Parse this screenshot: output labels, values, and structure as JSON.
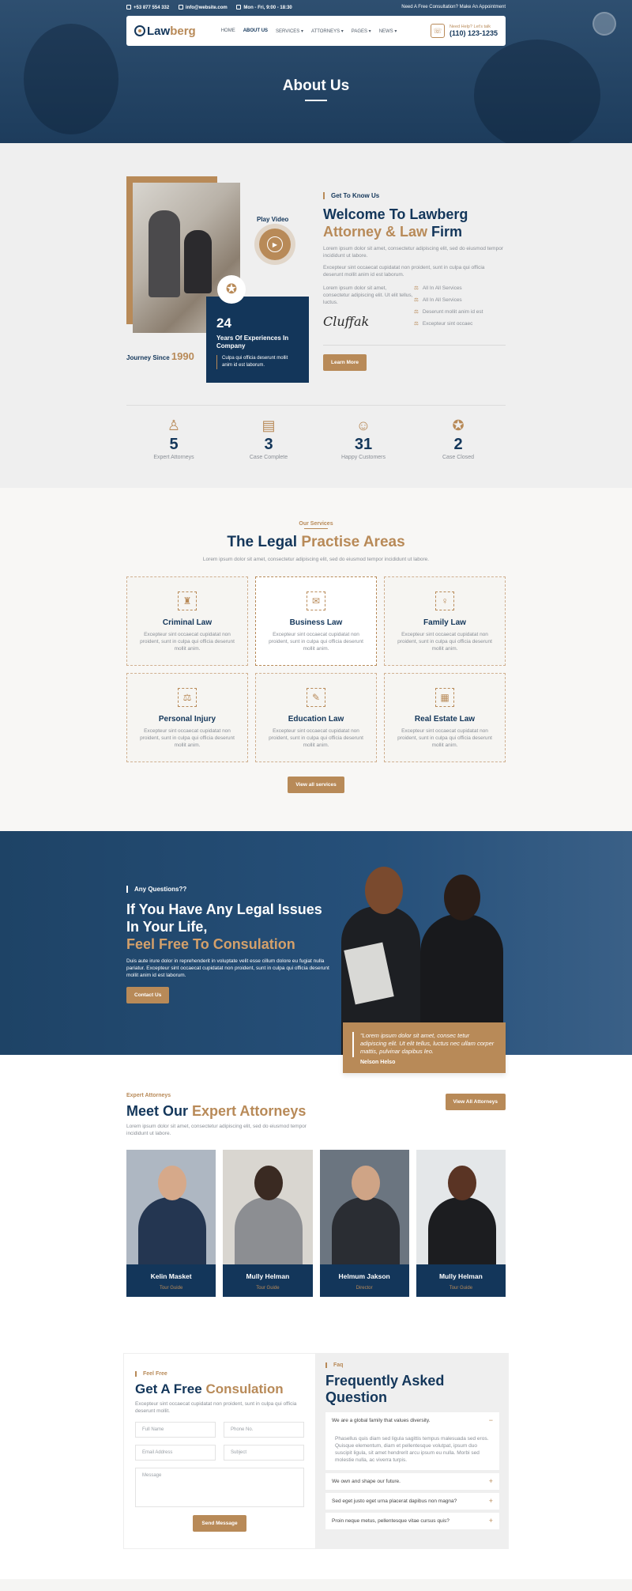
{
  "topbar": {
    "phone": "+53 877 554 332",
    "email": "info@website.com",
    "hours": "Mon - Fri, 9:00 - 18:30",
    "consult": "Need A Free Consultation? Make An Appointment"
  },
  "nav": {
    "logo_a": "Law",
    "logo_b": "berg",
    "items": [
      "HOME",
      "ABOUT US",
      "SERVICES ▾",
      "ATTORNEYS ▾",
      "PAGES ▾",
      "NEWS ▾"
    ],
    "help_label": "Need Help? Let's talk",
    "help_phone": "(110) 123-1235"
  },
  "hero": {
    "title": "About Us"
  },
  "about": {
    "play_label": "Play Video",
    "years": "24",
    "years_label": "Years Of Experiences In Company",
    "years_desc": "Culpa qui officia deserunt mollit anim id est laborum.",
    "journey_label": "Journey Since",
    "journey_year": "1990",
    "eyebrow": "Get To Know Us",
    "title_a": "Welcome To Lawberg",
    "title_b": "Attorney & Law",
    "title_c": "Firm",
    "p1": "Lorem ipsum dolor sit amet, consectetur adipiscing elit, sed do eiusmod tempor incididunt ut labore.",
    "p2": "Excepteur sint occaecat cupidatat non proident, sunt in culpa qui officia deserunt mollit anim id est laborum.",
    "p3": "Lorem ipsum dolor sit amet, consectetur adipiscing elit. Ut elit tellus, luctus.",
    "list": [
      "All In All Services",
      "All In All Services",
      "Deserunt mollit anim id est",
      "Excepteur sint occaec"
    ],
    "signature": "Cluffak",
    "button": "Learn More"
  },
  "stats": [
    {
      "icon": "♙",
      "num": "5",
      "label": "Expert Attorneys"
    },
    {
      "icon": "▤",
      "num": "3",
      "label": "Case Complete"
    },
    {
      "icon": "☺",
      "num": "31",
      "label": "Happy Customers"
    },
    {
      "icon": "✪",
      "num": "2",
      "label": "Case Closed"
    }
  ],
  "services": {
    "eyebrow": "Our Services",
    "title_a": "The Legal",
    "title_b": "Practise Areas",
    "sub": "Lorem ipsum dolor sit amet, consectetur adipiscing elit, sed do eiusmod tempor incididunt ut labore.",
    "cards": [
      {
        "icon": "♜",
        "title": "Criminal Law",
        "desc": "Excepteur sint occaecat cupidatat non proident, sunt in culpa qui officia deserunt mollit anim."
      },
      {
        "icon": "✉",
        "title": "Business Law",
        "desc": "Excepteur sint occaecat cupidatat non proident, sunt in culpa qui officia deserunt mollit anim."
      },
      {
        "icon": "♀",
        "title": "Family Law",
        "desc": "Excepteur sint occaecat cupidatat non proident, sunt in culpa qui officia deserunt mollit anim."
      },
      {
        "icon": "⚖",
        "title": "Personal Injury",
        "desc": "Excepteur sint occaecat cupidatat non proident, sunt in culpa qui officia deserunt mollit anim."
      },
      {
        "icon": "✎",
        "title": "Education Law",
        "desc": "Excepteur sint occaecat cupidatat non proident, sunt in culpa qui officia deserunt mollit anim."
      },
      {
        "icon": "▦",
        "title": "Real Estate Law",
        "desc": "Excepteur sint occaecat cupidatat non proident, sunt in culpa qui officia deserunt mollit anim."
      }
    ],
    "button": "View all services"
  },
  "cta": {
    "eyebrow": "Any Questions??",
    "title_a": "If You Have Any Legal Issues In Your Life,",
    "title_b": "Feel Free To Consulation",
    "text": "Duis aute irure dolor in reprehenderit in voluptate velit esse cillum dolore eu fugiat nulla pariatur. Excepteur sint occaecat cupidatat non proident, sunt in culpa qui officia deserunt mollit anim id est laborum.",
    "button": "Contact Us",
    "quote": "\"Lorem ipsum dolor sit amet, consec tetur adipiscing elit. Ut elit tellus, luctus nec ullam corper mattis, pulvinar dapibus leo.",
    "quote_name": "Nelson Helso"
  },
  "team": {
    "eyebrow": "Expert Attorneys",
    "title_a": "Meet Our",
    "title_b": "Expert Attorneys",
    "sub": "Lorem ipsum dolor sit amet, consectetur adipiscing elit, sed do eiusmod tempor incididunt ut labore.",
    "button": "View All Attorneys",
    "members": [
      {
        "name": "Kelin Masket",
        "role": "Tour Guide"
      },
      {
        "name": "Mully Helman",
        "role": "Tour Guide"
      },
      {
        "name": "Helmum Jakson",
        "role": "Director"
      },
      {
        "name": "Mully Helman",
        "role": "Tour Guide"
      }
    ]
  },
  "contact": {
    "eyebrow": "Feel Free",
    "title_a": "Get A Free",
    "title_b": "Consulation",
    "text": "Excepteur sint occaecat cupidatat non proident, sunt in culpa qui officia deserunt mollit.",
    "ph_name": "Full Name",
    "ph_phone": "Phone No.",
    "ph_email": "Email Address",
    "ph_subject": "Subject",
    "ph_message": "Message",
    "button": "Send Message"
  },
  "faq": {
    "eyebrow": "Faq",
    "title": "Frequently Asked Question",
    "q1": "We are a global family that values diversity.",
    "a1": "Phasellus quis diam sed ligula sagittis tempus malesuada sed eros. Quisque elementum, diam et pellentesque volutpat, ipsum duo suscipit ligula, sit amet hendrerit arcu ipsum eu nulla. Morbi sed molestie nulla, ac viverra turpis.",
    "q2": "We own and shape our future.",
    "q3": "Sed eget justo eget urna placerat dapibus non magna?",
    "q4": "Proin neque metus, pellentesque vitae cursus quis?"
  }
}
